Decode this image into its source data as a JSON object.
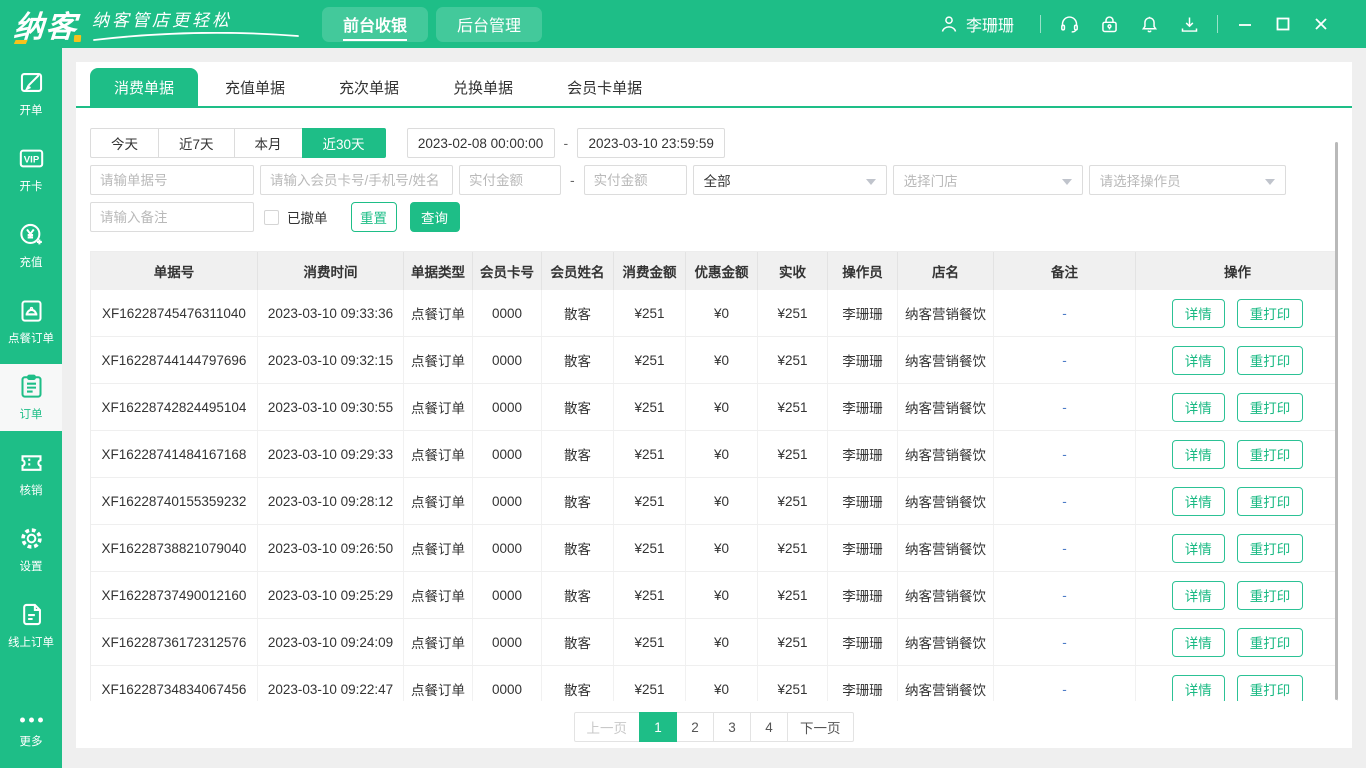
{
  "brand": {
    "logo": "纳客",
    "tagline": "纳客管店更轻松"
  },
  "topbar": {
    "tabs": [
      {
        "label": "前台收银",
        "active": true
      },
      {
        "label": "后台管理",
        "active": false
      }
    ],
    "username": "李珊珊"
  },
  "sidebar": {
    "vip_icon_text": "VIP",
    "items": [
      {
        "label": "开单",
        "active": false
      },
      {
        "label": "开卡",
        "active": false
      },
      {
        "label": "充值",
        "active": false
      },
      {
        "label": "点餐订单",
        "active": false
      },
      {
        "label": "订单",
        "active": true
      },
      {
        "label": "核销",
        "active": false
      },
      {
        "label": "设置",
        "active": false
      },
      {
        "label": "线上订单",
        "active": false
      },
      {
        "label": "更多",
        "active": false
      }
    ]
  },
  "tabs": [
    {
      "label": "消费单据",
      "active": true
    },
    {
      "label": "充值单据",
      "active": false
    },
    {
      "label": "充次单据",
      "active": false
    },
    {
      "label": "兑换单据",
      "active": false
    },
    {
      "label": "会员卡单据",
      "active": false
    }
  ],
  "filters": {
    "quick_dates": [
      {
        "label": "今天",
        "active": false
      },
      {
        "label": "近7天",
        "active": false
      },
      {
        "label": "本月",
        "active": false
      },
      {
        "label": "近30天",
        "active": true
      }
    ],
    "date_from": "2023-02-08 00:00:00",
    "date_to": "2023-03-10 23:59:59",
    "range_separator": "-",
    "order_no_placeholder": "请输单据号",
    "member_placeholder": "请输入会员卡号/手机号/姓名",
    "amount_min_placeholder": "实付金额",
    "amount_max_placeholder": "实付金额",
    "amount_separator": "-",
    "type_select_value": "全部",
    "store_select_placeholder": "选择门店",
    "operator_select_placeholder": "请选择操作员",
    "remark_placeholder": "请输入备注",
    "cancelled_checkbox_label": "已撤单",
    "cancelled_checked": false,
    "reset_button": "重置",
    "search_button": "查询"
  },
  "table": {
    "columns": [
      "单据号",
      "消费时间",
      "单据类型",
      "会员卡号",
      "会员姓名",
      "消费金额",
      "优惠金额",
      "实收",
      "操作员",
      "店名",
      "备注",
      "操作"
    ],
    "action_labels": {
      "detail": "详情",
      "reprint": "重打印"
    },
    "rows": [
      {
        "order_no": "XF16228745476311040",
        "time": "2023-03-10 09:33:36",
        "type": "点餐订单",
        "card_no": "0000",
        "member_name": "散客",
        "amount": "¥251",
        "discount": "¥0",
        "paid": "¥251",
        "operator": "李珊珊",
        "store": "纳客营销餐饮",
        "remark": "-"
      },
      {
        "order_no": "XF16228744144797696",
        "time": "2023-03-10 09:32:15",
        "type": "点餐订单",
        "card_no": "0000",
        "member_name": "散客",
        "amount": "¥251",
        "discount": "¥0",
        "paid": "¥251",
        "operator": "李珊珊",
        "store": "纳客营销餐饮",
        "remark": "-"
      },
      {
        "order_no": "XF16228742824495104",
        "time": "2023-03-10 09:30:55",
        "type": "点餐订单",
        "card_no": "0000",
        "member_name": "散客",
        "amount": "¥251",
        "discount": "¥0",
        "paid": "¥251",
        "operator": "李珊珊",
        "store": "纳客营销餐饮",
        "remark": "-"
      },
      {
        "order_no": "XF16228741484167168",
        "time": "2023-03-10 09:29:33",
        "type": "点餐订单",
        "card_no": "0000",
        "member_name": "散客",
        "amount": "¥251",
        "discount": "¥0",
        "paid": "¥251",
        "operator": "李珊珊",
        "store": "纳客营销餐饮",
        "remark": "-"
      },
      {
        "order_no": "XF16228740155359232",
        "time": "2023-03-10 09:28:12",
        "type": "点餐订单",
        "card_no": "0000",
        "member_name": "散客",
        "amount": "¥251",
        "discount": "¥0",
        "paid": "¥251",
        "operator": "李珊珊",
        "store": "纳客营销餐饮",
        "remark": "-"
      },
      {
        "order_no": "XF16228738821079040",
        "time": "2023-03-10 09:26:50",
        "type": "点餐订单",
        "card_no": "0000",
        "member_name": "散客",
        "amount": "¥251",
        "discount": "¥0",
        "paid": "¥251",
        "operator": "李珊珊",
        "store": "纳客营销餐饮",
        "remark": "-"
      },
      {
        "order_no": "XF16228737490012160",
        "time": "2023-03-10 09:25:29",
        "type": "点餐订单",
        "card_no": "0000",
        "member_name": "散客",
        "amount": "¥251",
        "discount": "¥0",
        "paid": "¥251",
        "operator": "李珊珊",
        "store": "纳客营销餐饮",
        "remark": "-"
      },
      {
        "order_no": "XF16228736172312576",
        "time": "2023-03-10 09:24:09",
        "type": "点餐订单",
        "card_no": "0000",
        "member_name": "散客",
        "amount": "¥251",
        "discount": "¥0",
        "paid": "¥251",
        "operator": "李珊珊",
        "store": "纳客营销餐饮",
        "remark": "-"
      },
      {
        "order_no": "XF16228734834067456",
        "time": "2023-03-10 09:22:47",
        "type": "点餐订单",
        "card_no": "0000",
        "member_name": "散客",
        "amount": "¥251",
        "discount": "¥0",
        "paid": "¥251",
        "operator": "李珊珊",
        "store": "纳客营销餐饮",
        "remark": "-"
      }
    ]
  },
  "pagination": {
    "prev": "上一页",
    "next": "下一页",
    "pages": [
      {
        "label": "1",
        "active": true
      },
      {
        "label": "2",
        "active": false
      },
      {
        "label": "3",
        "active": false
      },
      {
        "label": "4",
        "active": false
      }
    ]
  },
  "colors": {
    "primary": "#1ebe87",
    "accent_yellow": "#f6c21c",
    "remark_dash": "#4d7cc7"
  }
}
